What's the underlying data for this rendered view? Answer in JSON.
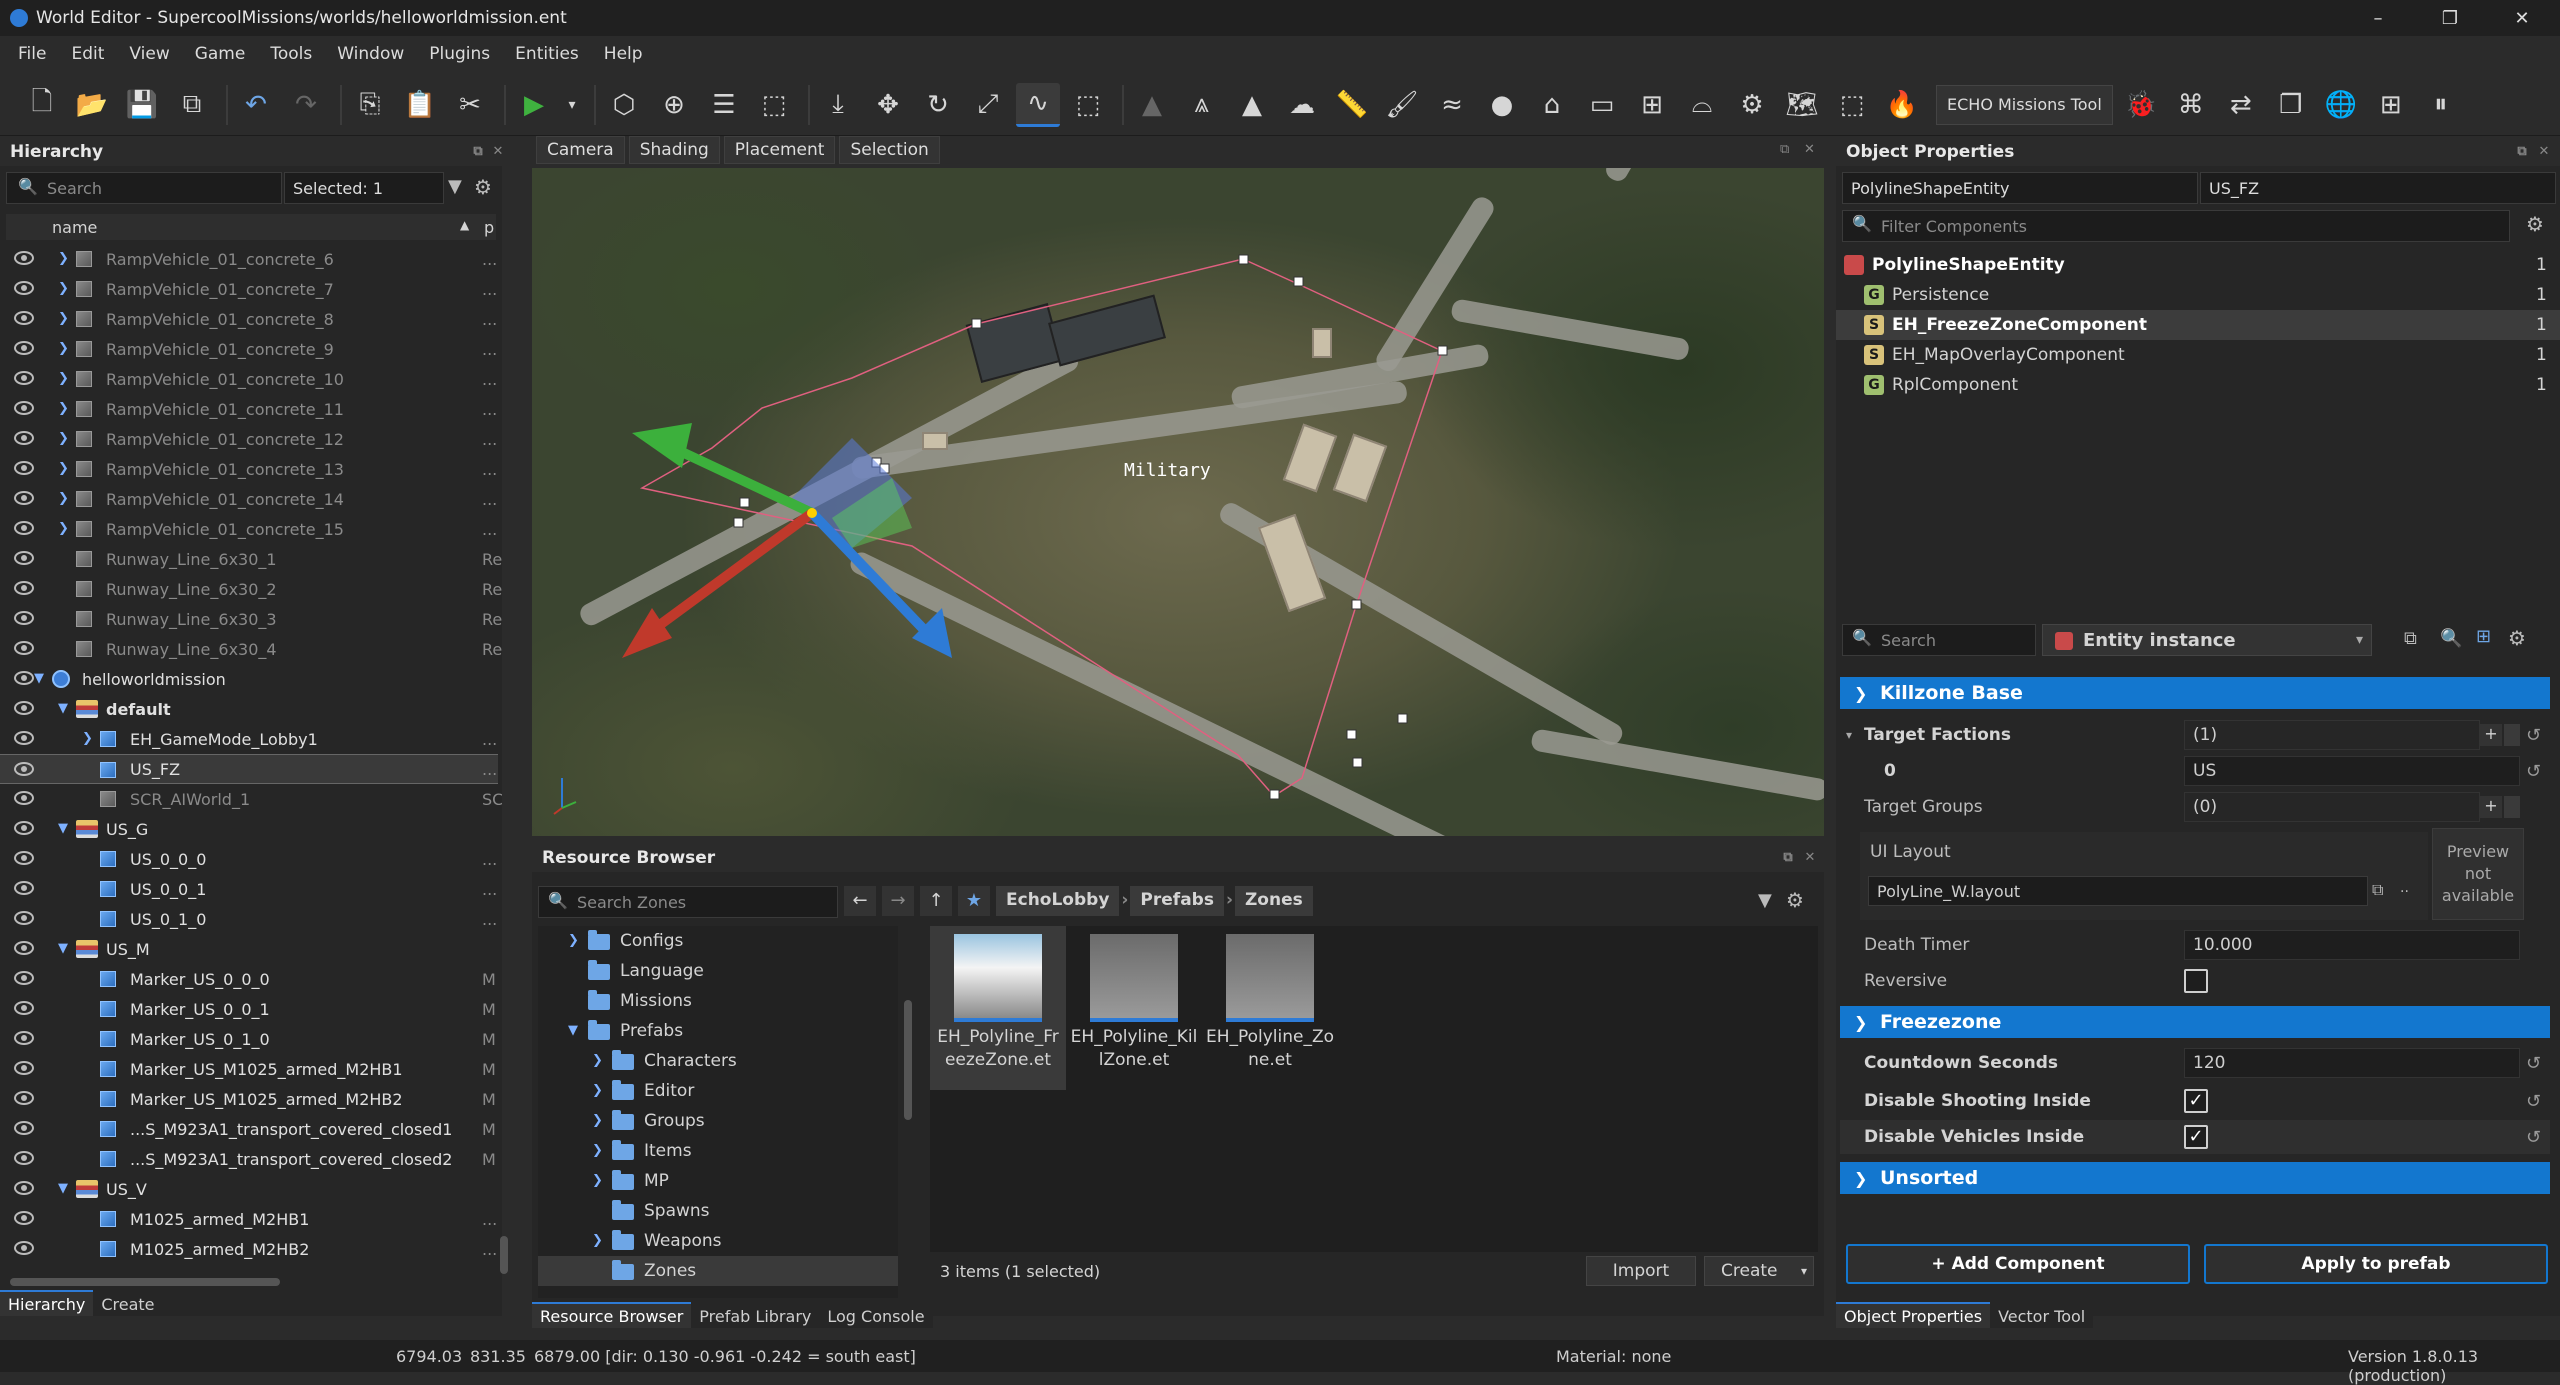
{
  "window": {
    "title": "World Editor - SupercoolMissions/worlds/helloworldmission.ent",
    "minimize": "–",
    "maximize": "❐",
    "close": "✕"
  },
  "menu": [
    "File",
    "Edit",
    "View",
    "Game",
    "Tools",
    "Window",
    "Plugins",
    "Entities",
    "Help"
  ],
  "toolbar": {
    "echo_button": "ECHO Missions Tool"
  },
  "hierarchy": {
    "title": "Hierarchy",
    "search_placeholder": "Search",
    "selected": "Selected: 1",
    "col_name": "name",
    "col_p": "p",
    "rows": [
      {
        "name": "RampVehicle_01_concrete_6",
        "extra": "..."
      },
      {
        "name": "RampVehicle_01_concrete_7",
        "extra": "..."
      },
      {
        "name": "RampVehicle_01_concrete_8",
        "extra": "..."
      },
      {
        "name": "RampVehicle_01_concrete_9",
        "extra": "..."
      },
      {
        "name": "RampVehicle_01_concrete_10",
        "extra": "..."
      },
      {
        "name": "RampVehicle_01_concrete_11",
        "extra": "..."
      },
      {
        "name": "RampVehicle_01_concrete_12",
        "extra": "..."
      },
      {
        "name": "RampVehicle_01_concrete_13",
        "extra": "..."
      },
      {
        "name": "RampVehicle_01_concrete_14",
        "extra": "..."
      },
      {
        "name": "RampVehicle_01_concrete_15",
        "extra": "..."
      },
      {
        "name": "Runway_Line_6x30_1",
        "extra": "Re"
      },
      {
        "name": "Runway_Line_6x30_2",
        "extra": "Re"
      },
      {
        "name": "Runway_Line_6x30_3",
        "extra": "Re"
      },
      {
        "name": "Runway_Line_6x30_4",
        "extra": "Re"
      },
      {
        "name": "helloworldmission",
        "extra": ""
      },
      {
        "name": "default",
        "extra": ""
      },
      {
        "name": "EH_GameMode_Lobby1",
        "extra": "..."
      },
      {
        "name": "US_FZ",
        "extra": "..."
      },
      {
        "name": "SCR_AIWorld_1",
        "extra": "SC"
      },
      {
        "name": "US_G",
        "extra": ""
      },
      {
        "name": "US_0_0_0",
        "extra": "..."
      },
      {
        "name": "US_0_0_1",
        "extra": "..."
      },
      {
        "name": "US_0_1_0",
        "extra": "..."
      },
      {
        "name": "US_M",
        "extra": ""
      },
      {
        "name": "Marker_US_0_0_0",
        "extra": "M"
      },
      {
        "name": "Marker_US_0_0_1",
        "extra": "M"
      },
      {
        "name": "Marker_US_0_1_0",
        "extra": "M"
      },
      {
        "name": "Marker_US_M1025_armed_M2HB1",
        "extra": "M"
      },
      {
        "name": "Marker_US_M1025_armed_M2HB2",
        "extra": "M"
      },
      {
        "name": "...S_M923A1_transport_covered_closed1",
        "extra": "M"
      },
      {
        "name": "...S_M923A1_transport_covered_closed2",
        "extra": "M"
      },
      {
        "name": "US_V",
        "extra": ""
      },
      {
        "name": "M1025_armed_M2HB1",
        "extra": "..."
      },
      {
        "name": "M1025_armed_M2HB2",
        "extra": "..."
      }
    ],
    "tabs": [
      "Hierarchy",
      "Create"
    ]
  },
  "viewport": {
    "tabs": [
      "Camera",
      "Shading",
      "Placement",
      "Selection"
    ],
    "label": "Military"
  },
  "resource_browser": {
    "title": "Resource Browser",
    "search_placeholder": "Search Zones",
    "breadcrumb": [
      "EchoLobby",
      "Prefabs",
      "Zones"
    ],
    "tree": [
      {
        "name": "Configs",
        "expandable": true,
        "indent": 1
      },
      {
        "name": "Language",
        "expandable": false,
        "indent": 1
      },
      {
        "name": "Missions",
        "expandable": false,
        "indent": 1
      },
      {
        "name": "Prefabs",
        "expandable": true,
        "open": true,
        "indent": 1
      },
      {
        "name": "Characters",
        "expandable": true,
        "indent": 2
      },
      {
        "name": "Editor",
        "expandable": true,
        "indent": 2
      },
      {
        "name": "Groups",
        "expandable": true,
        "indent": 2
      },
      {
        "name": "Items",
        "expandable": true,
        "indent": 2
      },
      {
        "name": "MP",
        "expandable": true,
        "indent": 2
      },
      {
        "name": "Spawns",
        "expandable": false,
        "indent": 2
      },
      {
        "name": "Weapons",
        "expandable": true,
        "indent": 2
      },
      {
        "name": "Zones",
        "expandable": false,
        "indent": 2
      }
    ],
    "files": [
      {
        "l1": "EH_Polyline_Fr",
        "l2": "eezeZone.et"
      },
      {
        "l1": "EH_Polyline_Kil",
        "l2": "lZone.et"
      },
      {
        "l1": "EH_Polyline_Zo",
        "l2": "ne.et"
      }
    ],
    "count": "3 items (1 selected)",
    "import": "Import",
    "create": "Create",
    "tabs": [
      "Resource Browser",
      "Prefab Library",
      "Log Console"
    ]
  },
  "object_properties": {
    "title": "Object Properties",
    "class": "PolylineShapeEntity",
    "name": "US_FZ",
    "filter_placeholder": "Filter Components",
    "components": [
      {
        "name": "PolylineShapeEntity",
        "count": "1",
        "icon": "",
        "color": "#c94a4a"
      },
      {
        "name": "Persistence",
        "count": "1",
        "icon": "G",
        "color": "#9fbf6f"
      },
      {
        "name": "EH_FreezeZoneComponent",
        "count": "1",
        "icon": "S",
        "color": "#d8c27a"
      },
      {
        "name": "EH_MapOverlayComponent",
        "count": "1",
        "icon": "S",
        "color": "#d8c27a"
      },
      {
        "name": "RplComponent",
        "count": "1",
        "icon": "G",
        "color": "#9fbf6f"
      }
    ],
    "search_placeholder": "Search",
    "instance": "Entity instance",
    "sections": {
      "killzone": "Killzone Base",
      "freezezone": "Freezezone",
      "unsorted": "Unsorted"
    },
    "props": {
      "target_factions": "Target Factions",
      "target_factions_val": "(1)",
      "index0": "0",
      "index0_val": "US",
      "target_groups": "Target Groups",
      "target_groups_val": "(0)",
      "ui_layout": "UI Layout",
      "ui_layout_val": "PolyLine_W.layout",
      "preview": "Preview not available",
      "death_timer": "Death Timer",
      "death_timer_val": "10.000",
      "reversive": "Reversive",
      "countdown": "Countdown Seconds",
      "countdown_val": "120",
      "disable_shooting": "Disable Shooting Inside",
      "disable_vehicles": "Disable Vehicles Inside"
    },
    "add_component": "+ Add Component",
    "apply_prefab": "Apply to prefab",
    "tabs": [
      "Object Properties",
      "Vector Tool"
    ]
  },
  "status": {
    "c1": "6794.03",
    "c2": "831.35",
    "c3": "6879.00 [dir: 0.130 -0.961 -0.242 = south east]",
    "material": "Material: none",
    "version": "Version 1.8.0.13 (production)"
  }
}
